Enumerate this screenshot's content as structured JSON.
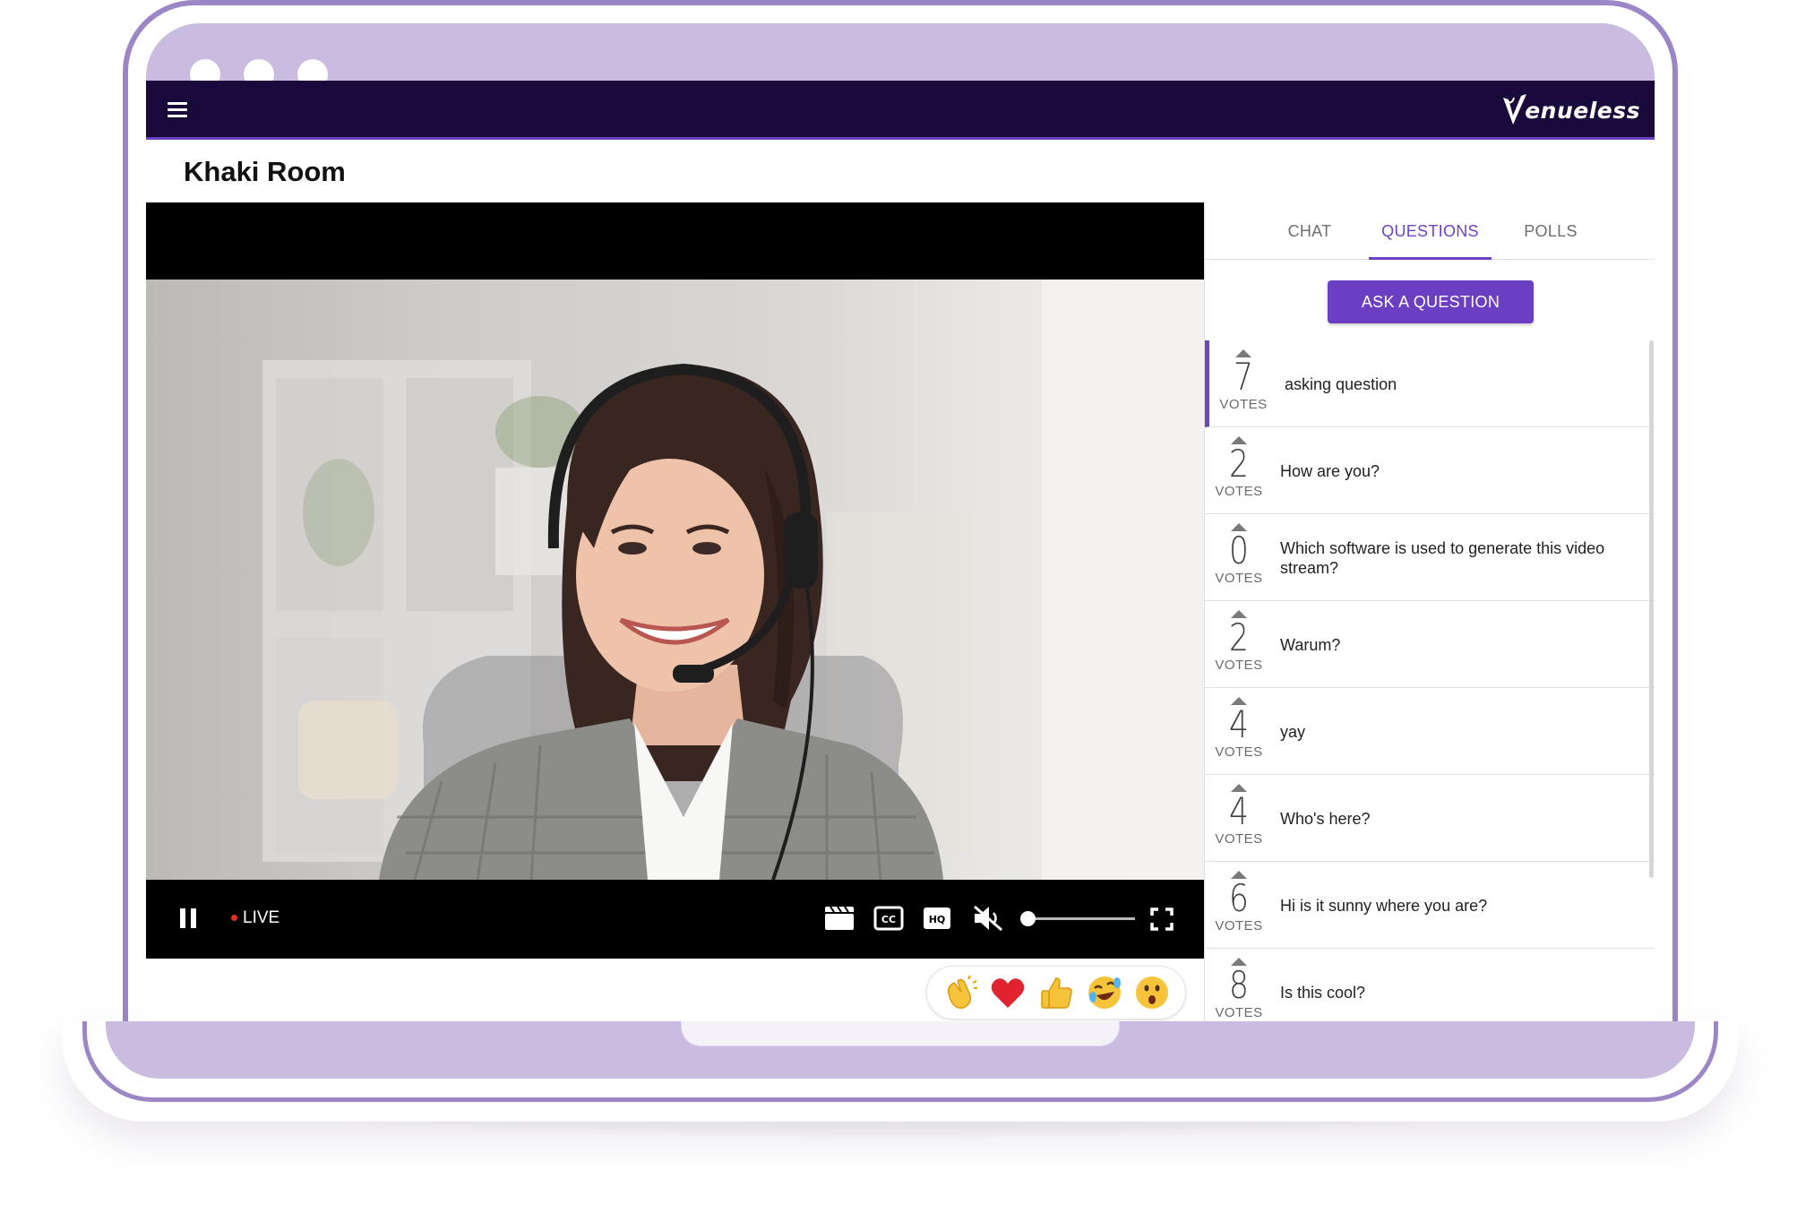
{
  "app": {
    "brand": "Venueless"
  },
  "room": {
    "title": "Khaki Room"
  },
  "player": {
    "live_label": "LIVE",
    "volume_level": 0
  },
  "tabs": [
    {
      "label": "CHAT"
    },
    {
      "label": "QUESTIONS"
    },
    {
      "label": "POLLS"
    }
  ],
  "questions": {
    "ask_label": "ASK A QUESTION",
    "votes_label": "VOTES",
    "items": [
      {
        "votes": "7",
        "text": "asking question"
      },
      {
        "votes": "2",
        "text": "How are you?"
      },
      {
        "votes": "0",
        "text": "Which software is used to generate this video stream?"
      },
      {
        "votes": "2",
        "text": "Warum?"
      },
      {
        "votes": "4",
        "text": "yay"
      },
      {
        "votes": "4",
        "text": "Who's here?"
      },
      {
        "votes": "6",
        "text": "Hi is it sunny where you are?"
      },
      {
        "votes": "8",
        "text": "Is this cool?"
      }
    ]
  },
  "reactions": [
    "clap-icon",
    "heart-icon",
    "thumbs-up-icon",
    "laughing-icon",
    "surprised-icon"
  ],
  "colors": {
    "topbar": "#1a0a3c",
    "accent": "#6c43c0",
    "laptop_frame": "#c9bce0"
  }
}
